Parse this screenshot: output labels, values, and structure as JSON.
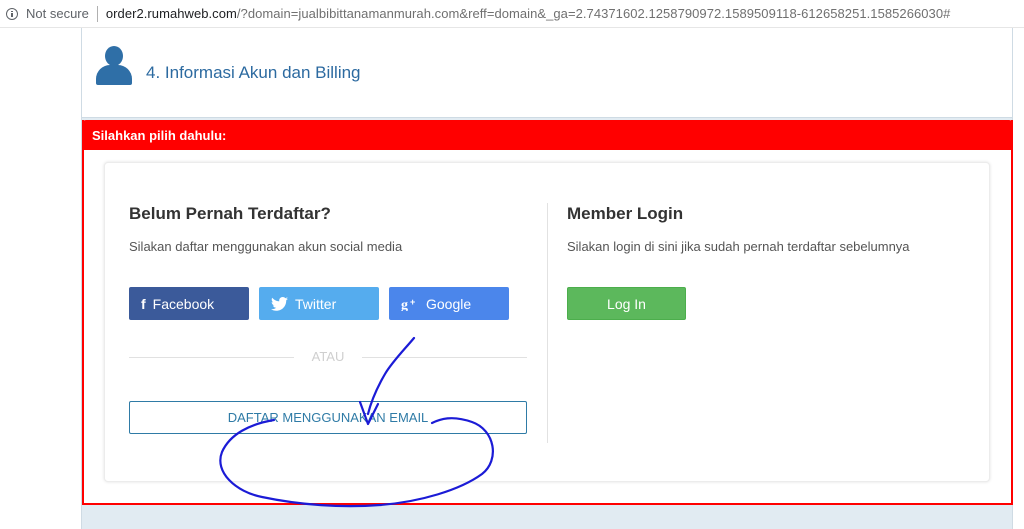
{
  "browser": {
    "security_label": "Not secure",
    "url_host": "order2.rumahweb.com",
    "url_rest": "/?domain=jualbibittanamanmurah.com&reff=domain&_ga=2.74371602.1258790972.1589509118-612658251.1585266030#"
  },
  "step": {
    "title": "4. Informasi Akun dan Billing",
    "icon": "user-icon"
  },
  "alert": {
    "heading": "Silahkan pilih dahulu:",
    "color": "#ff0000"
  },
  "register": {
    "title": "Belum Pernah Terdaftar?",
    "subtitle": "Silakan daftar menggunakan akun social media",
    "facebook_label": "Facebook",
    "twitter_label": "Twitter",
    "google_label": "Google",
    "divider_text": "ATAU",
    "email_button_label": "DAFTAR MENGGUNAKAN EMAIL"
  },
  "login": {
    "title": "Member Login",
    "subtitle": "Silakan login di sini jika sudah pernah terdaftar sebelumnya",
    "button_label": "Log In"
  },
  "colors": {
    "facebook": "#3b5a9a",
    "twitter": "#55acee",
    "google": "#4b86eb",
    "login": "#5cb85c",
    "annotation": "#1b1bd6"
  }
}
